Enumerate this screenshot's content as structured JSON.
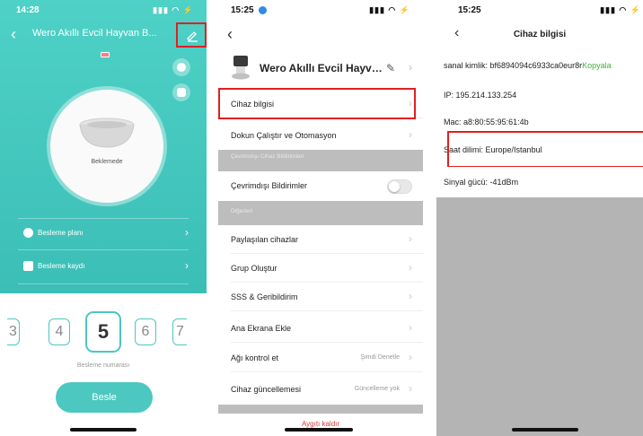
{
  "panel1": {
    "status_time": "14:28",
    "status_icons": "…• ▽",
    "title": "Wero Akıllı Evcil Hayvan B...",
    "bowl_status": "Beklemede",
    "feeding_plan": "Besleme planı",
    "feeding_log": "Besleme kaydı",
    "numbers": [
      "3",
      "4",
      "5",
      "6",
      "7"
    ],
    "number_label": "Besleme numarası",
    "feed_button": "Besle"
  },
  "panel2": {
    "status_time": "15:25",
    "title": "Wero Akıllı Evcil Hayvan...",
    "device_info": "Cihaz bilgisi",
    "tap_run": "Dokun Çalıştır ve Otomasyon",
    "offline_section": "Çevrimdışı Cihaz Bildirimleri",
    "offline_notif": "Çevrimdışı Bildirimler",
    "others_section": "Diğerleri",
    "shared": "Paylaşılan cihazlar",
    "group": "Grup Oluştur",
    "faq": "SSS & Geribildirim",
    "home_add": "Ana Ekrana Ekle",
    "network": "Ağı kontrol et",
    "network_value": "Şimdi Denetle",
    "update": "Cihaz güncellemesi",
    "update_value": "Güncelleme yok",
    "remove": "Aygıtı kaldır"
  },
  "panel3": {
    "status_time": "15:25",
    "title": "Cihaz bilgisi",
    "virtual_id_label": "sanal kimlik:",
    "virtual_id_value": "bf6894094c6933ca0eur8r",
    "copy": "Kopyala",
    "ip_label": "IP:",
    "ip_value": "195.214.133.254",
    "mac_label": "Mac:",
    "mac_value": "a8:80:55:95:61:4b",
    "tz_label": "Saat dilimi:",
    "tz_value": "Europe/Istanbul",
    "signal_label": "Sinyal gücü:",
    "signal_value": "-41dBm"
  }
}
